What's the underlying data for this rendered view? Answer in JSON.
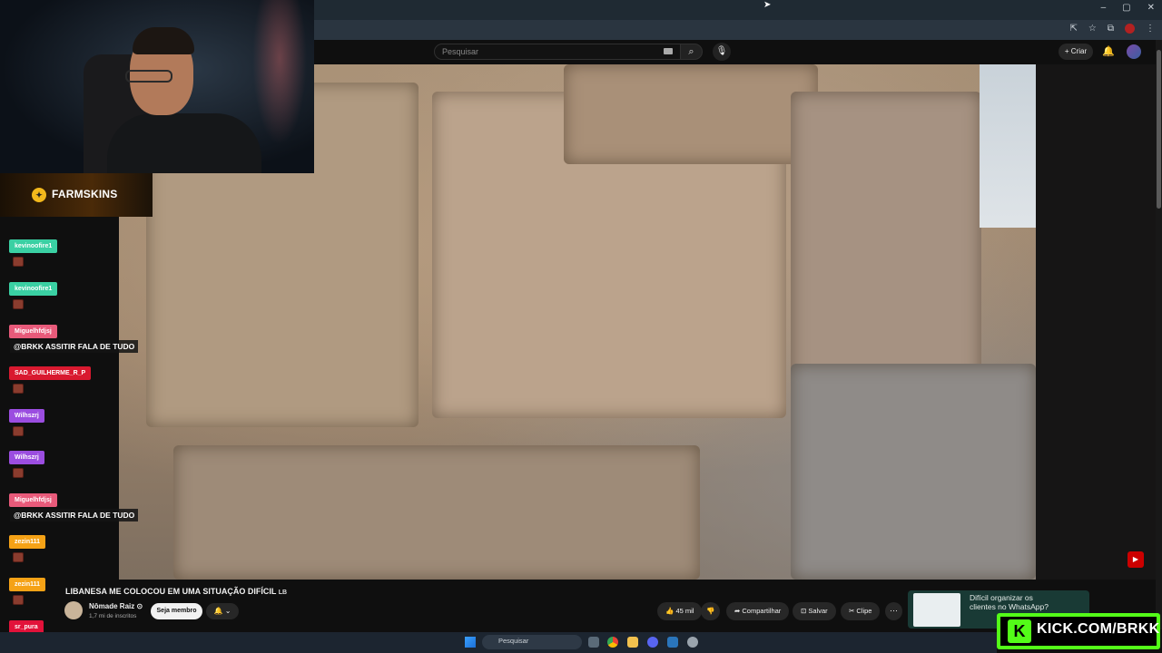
{
  "browser": {
    "window_controls": [
      "–",
      "▢",
      "✕"
    ],
    "address_icons": [
      "cast-icon",
      "star-icon",
      "extensions-icon",
      "profile-icon",
      "menu-icon"
    ]
  },
  "youtube_header": {
    "search_placeholder": "Pesquisar",
    "create_label": "Criar"
  },
  "stream_overlay": {
    "sponsor": "FARMSKINS",
    "kick_url": "KICK.COM/BRKK"
  },
  "chat": [
    {
      "user": "kevinoofire1",
      "color": "#3ad0a3",
      "message": ""
    },
    {
      "user": "kevinoofire1",
      "color": "#3ad0a3",
      "message": ""
    },
    {
      "user": "Miguelhfdjsj",
      "color": "#e85a7a",
      "message": "@BRKK ASSITIR FALA DE TUDO"
    },
    {
      "user": "SAD_GUILHERME_R_P",
      "color": "#d9192f",
      "message": ""
    },
    {
      "user": "Wilhszrj",
      "color": "#9b4de0",
      "message": ""
    },
    {
      "user": "Wilhszrj",
      "color": "#9b4de0",
      "message": ""
    },
    {
      "user": "Miguelhfdjsj",
      "color": "#e85a7a",
      "message": "@BRKK ASSITIR FALA DE TUDO"
    },
    {
      "user": "zezin111",
      "color": "#f5a216",
      "message": ""
    },
    {
      "user": "zezin111",
      "color": "#f5a216",
      "message": ""
    },
    {
      "user": "sr_pura",
      "color": "#e2123a",
      "message": ""
    }
  ],
  "video": {
    "title": "LIBANESA ME COLOCOU EM UMA SITUAÇÃO DIFÍCIL",
    "title_badge": "LB",
    "channel": "Nômade Raiz",
    "subscribers": "1,7 mi de inscritos",
    "member_label": "Seja membro",
    "likes": "45 mil",
    "share_label": "Compartilhar",
    "save_label": "Salvar",
    "clip_label": "Clipe"
  },
  "ad": {
    "text": "Difícil organizar os clientes no WhatsApp?"
  },
  "taskbar": {
    "search_placeholder": "Pesquisar"
  }
}
